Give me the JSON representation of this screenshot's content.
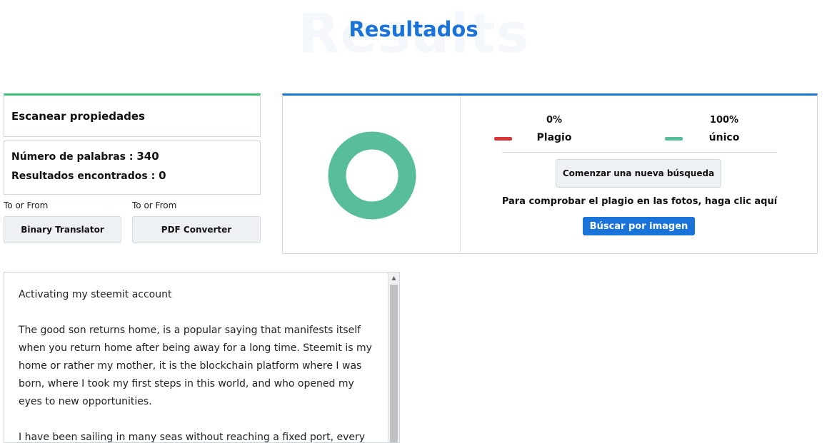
{
  "header": {
    "watermark": "Results",
    "title": "Resultados"
  },
  "scan": {
    "heading": "Escanear propiedades",
    "word_count_label": "Número de palabras : ",
    "word_count": "340",
    "results_label": "Resultados encontrados : ",
    "results_count": "0"
  },
  "tools": [
    {
      "label": "To or From",
      "button": "Binary Translator"
    },
    {
      "label": "To or From",
      "button": "PDF Converter"
    }
  ],
  "results": {
    "plagiarism": {
      "percent": "0%",
      "label": "Plagio",
      "color": "#d9343a",
      "value": 0
    },
    "unique": {
      "percent": "100%",
      "label": "único",
      "color": "#58bd9b",
      "value": 100
    },
    "new_search_button": "Comenzar una nueva búsqueda",
    "image_check_text": "Para comprobar el plagio en las fotos, haga clic aquí",
    "image_search_button": "Búscar por imagen"
  },
  "text_input": {
    "paragraphs": [
      "Activating my steemit account",
      "The good son returns home, is a popular saying that manifests itself when you return home after being away for a long time. Steemit is my home or rather my mother, it is the blockchain platform where I was born, where I took my first steps in this world, and who opened my eyes to new opportunities.",
      "I have been sailing in many seas without reaching a fixed port, every"
    ]
  }
}
